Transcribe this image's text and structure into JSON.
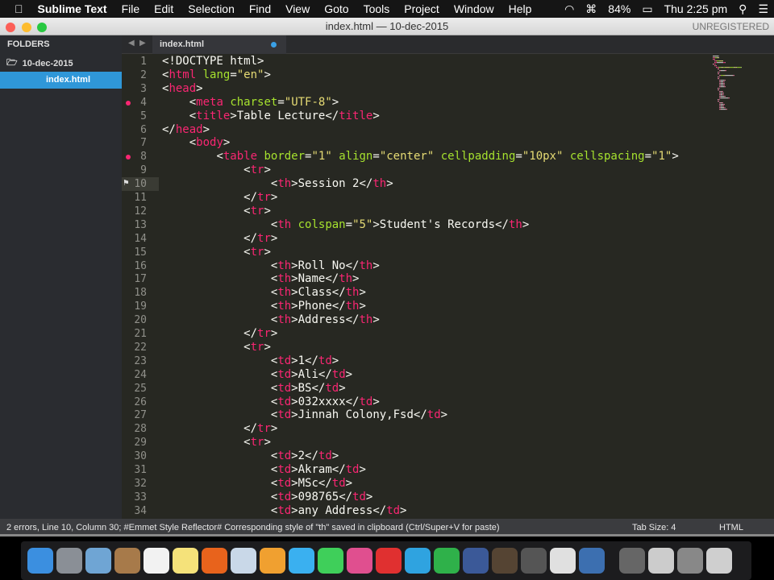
{
  "menubar": {
    "app": "Sublime Text",
    "items": [
      "File",
      "Edit",
      "Selection",
      "Find",
      "View",
      "Goto",
      "Tools",
      "Project",
      "Window",
      "Help"
    ],
    "battery": "84%",
    "clock": "Thu 2:25 pm"
  },
  "window": {
    "title": "index.html — 10-dec-2015",
    "registration": "UNREGISTERED"
  },
  "sidebar": {
    "header": "FOLDERS",
    "folder": "10-dec-2015",
    "file": "index.html"
  },
  "tab": {
    "label": "index.html"
  },
  "editor": {
    "current_line": 10,
    "error_lines": [
      4,
      8
    ],
    "lines": [
      [
        0,
        [
          [
            "p",
            "<!DOCTYPE html>"
          ]
        ]
      ],
      [
        0,
        [
          [
            "p",
            "<"
          ],
          [
            "t",
            "html"
          ],
          [
            "p",
            " "
          ],
          [
            "a",
            "lang"
          ],
          [
            "p",
            "="
          ],
          [
            "s",
            "\"en\""
          ],
          [
            "p",
            ">"
          ]
        ]
      ],
      [
        0,
        [
          [
            "p",
            "<"
          ],
          [
            "t",
            "head"
          ],
          [
            "p",
            ">"
          ]
        ]
      ],
      [
        4,
        [
          [
            "p",
            "<"
          ],
          [
            "t",
            "meta"
          ],
          [
            "p",
            " "
          ],
          [
            "a",
            "charset"
          ],
          [
            "p",
            "="
          ],
          [
            "s",
            "\"UTF-8\""
          ],
          [
            "p",
            ">"
          ]
        ]
      ],
      [
        4,
        [
          [
            "p",
            "<"
          ],
          [
            "t",
            "title"
          ],
          [
            "p",
            ">"
          ],
          [
            "x",
            "Table Lecture"
          ],
          [
            "p",
            "</"
          ],
          [
            "t",
            "title"
          ],
          [
            "p",
            ">"
          ]
        ]
      ],
      [
        0,
        [
          [
            "p",
            "</"
          ],
          [
            "t",
            "head"
          ],
          [
            "p",
            ">"
          ]
        ]
      ],
      [
        4,
        [
          [
            "p",
            "<"
          ],
          [
            "t",
            "body"
          ],
          [
            "p",
            ">"
          ]
        ]
      ],
      [
        8,
        [
          [
            "p",
            "<"
          ],
          [
            "t",
            "table"
          ],
          [
            "p",
            " "
          ],
          [
            "a",
            "border"
          ],
          [
            "p",
            "="
          ],
          [
            "s",
            "\"1\""
          ],
          [
            "p",
            " "
          ],
          [
            "a",
            "align"
          ],
          [
            "p",
            "="
          ],
          [
            "s",
            "\"center\""
          ],
          [
            "p",
            " "
          ],
          [
            "a",
            "cellpadding"
          ],
          [
            "p",
            "="
          ],
          [
            "s",
            "\"10px\""
          ],
          [
            "p",
            " "
          ],
          [
            "a",
            "cellspacing"
          ],
          [
            "p",
            "="
          ],
          [
            "s",
            "\"1\""
          ],
          [
            "p",
            ">"
          ]
        ]
      ],
      [
        12,
        [
          [
            "p",
            "<"
          ],
          [
            "t",
            "tr"
          ],
          [
            "p",
            ">"
          ]
        ]
      ],
      [
        16,
        [
          [
            "p",
            "<"
          ],
          [
            "t",
            "th"
          ],
          [
            "p",
            ">"
          ],
          [
            "x",
            "Session 2"
          ],
          [
            "p",
            "</"
          ],
          [
            "t",
            "th"
          ],
          [
            "p",
            ">"
          ]
        ]
      ],
      [
        12,
        [
          [
            "p",
            "</"
          ],
          [
            "t",
            "tr"
          ],
          [
            "p",
            ">"
          ]
        ]
      ],
      [
        12,
        [
          [
            "p",
            "<"
          ],
          [
            "t",
            "tr"
          ],
          [
            "p",
            ">"
          ]
        ]
      ],
      [
        16,
        [
          [
            "p",
            "<"
          ],
          [
            "t",
            "th"
          ],
          [
            "p",
            " "
          ],
          [
            "a",
            "colspan"
          ],
          [
            "p",
            "="
          ],
          [
            "s",
            "\"5\""
          ],
          [
            "p",
            ">"
          ],
          [
            "x",
            "Student's Records"
          ],
          [
            "p",
            "</"
          ],
          [
            "t",
            "th"
          ],
          [
            "p",
            ">"
          ]
        ]
      ],
      [
        12,
        [
          [
            "p",
            "</"
          ],
          [
            "t",
            "tr"
          ],
          [
            "p",
            ">"
          ]
        ]
      ],
      [
        12,
        [
          [
            "p",
            "<"
          ],
          [
            "t",
            "tr"
          ],
          [
            "p",
            ">"
          ]
        ]
      ],
      [
        16,
        [
          [
            "p",
            "<"
          ],
          [
            "t",
            "th"
          ],
          [
            "p",
            ">"
          ],
          [
            "x",
            "Roll No"
          ],
          [
            "p",
            "</"
          ],
          [
            "t",
            "th"
          ],
          [
            "p",
            ">"
          ]
        ]
      ],
      [
        16,
        [
          [
            "p",
            "<"
          ],
          [
            "t",
            "th"
          ],
          [
            "p",
            ">"
          ],
          [
            "x",
            "Name"
          ],
          [
            "p",
            "</"
          ],
          [
            "t",
            "th"
          ],
          [
            "p",
            ">"
          ]
        ]
      ],
      [
        16,
        [
          [
            "p",
            "<"
          ],
          [
            "t",
            "th"
          ],
          [
            "p",
            ">"
          ],
          [
            "x",
            "Class"
          ],
          [
            "p",
            "</"
          ],
          [
            "t",
            "th"
          ],
          [
            "p",
            ">"
          ]
        ]
      ],
      [
        16,
        [
          [
            "p",
            "<"
          ],
          [
            "t",
            "th"
          ],
          [
            "p",
            ">"
          ],
          [
            "x",
            "Phone"
          ],
          [
            "p",
            "</"
          ],
          [
            "t",
            "th"
          ],
          [
            "p",
            ">"
          ]
        ]
      ],
      [
        16,
        [
          [
            "p",
            "<"
          ],
          [
            "t",
            "th"
          ],
          [
            "p",
            ">"
          ],
          [
            "x",
            "Address"
          ],
          [
            "p",
            "</"
          ],
          [
            "t",
            "th"
          ],
          [
            "p",
            ">"
          ]
        ]
      ],
      [
        12,
        [
          [
            "p",
            "</"
          ],
          [
            "t",
            "tr"
          ],
          [
            "p",
            ">"
          ]
        ]
      ],
      [
        12,
        [
          [
            "p",
            "<"
          ],
          [
            "t",
            "tr"
          ],
          [
            "p",
            ">"
          ]
        ]
      ],
      [
        16,
        [
          [
            "p",
            "<"
          ],
          [
            "t",
            "td"
          ],
          [
            "p",
            ">"
          ],
          [
            "x",
            "1"
          ],
          [
            "p",
            "</"
          ],
          [
            "t",
            "td"
          ],
          [
            "p",
            ">"
          ]
        ]
      ],
      [
        16,
        [
          [
            "p",
            "<"
          ],
          [
            "t",
            "td"
          ],
          [
            "p",
            ">"
          ],
          [
            "x",
            "Ali"
          ],
          [
            "p",
            "</"
          ],
          [
            "t",
            "td"
          ],
          [
            "p",
            ">"
          ]
        ]
      ],
      [
        16,
        [
          [
            "p",
            "<"
          ],
          [
            "t",
            "td"
          ],
          [
            "p",
            ">"
          ],
          [
            "x",
            "BS"
          ],
          [
            "p",
            "</"
          ],
          [
            "t",
            "td"
          ],
          [
            "p",
            ">"
          ]
        ]
      ],
      [
        16,
        [
          [
            "p",
            "<"
          ],
          [
            "t",
            "td"
          ],
          [
            "p",
            ">"
          ],
          [
            "x",
            "032xxxx"
          ],
          [
            "p",
            "</"
          ],
          [
            "t",
            "td"
          ],
          [
            "p",
            ">"
          ]
        ]
      ],
      [
        16,
        [
          [
            "p",
            "<"
          ],
          [
            "t",
            "td"
          ],
          [
            "p",
            ">"
          ],
          [
            "x",
            "Jinnah Colony,Fsd"
          ],
          [
            "p",
            "</"
          ],
          [
            "t",
            "td"
          ],
          [
            "p",
            ">"
          ]
        ]
      ],
      [
        12,
        [
          [
            "p",
            "</"
          ],
          [
            "t",
            "tr"
          ],
          [
            "p",
            ">"
          ]
        ]
      ],
      [
        12,
        [
          [
            "p",
            "<"
          ],
          [
            "t",
            "tr"
          ],
          [
            "p",
            ">"
          ]
        ]
      ],
      [
        16,
        [
          [
            "p",
            "<"
          ],
          [
            "t",
            "td"
          ],
          [
            "p",
            ">"
          ],
          [
            "x",
            "2"
          ],
          [
            "p",
            "</"
          ],
          [
            "t",
            "td"
          ],
          [
            "p",
            ">"
          ]
        ]
      ],
      [
        16,
        [
          [
            "p",
            "<"
          ],
          [
            "t",
            "td"
          ],
          [
            "p",
            ">"
          ],
          [
            "x",
            "Akram"
          ],
          [
            "p",
            "</"
          ],
          [
            "t",
            "td"
          ],
          [
            "p",
            ">"
          ]
        ]
      ],
      [
        16,
        [
          [
            "p",
            "<"
          ],
          [
            "t",
            "td"
          ],
          [
            "p",
            ">"
          ],
          [
            "x",
            "MSc"
          ],
          [
            "p",
            "</"
          ],
          [
            "t",
            "td"
          ],
          [
            "p",
            ">"
          ]
        ]
      ],
      [
        16,
        [
          [
            "p",
            "<"
          ],
          [
            "t",
            "td"
          ],
          [
            "p",
            ">"
          ],
          [
            "x",
            "098765"
          ],
          [
            "p",
            "</"
          ],
          [
            "t",
            "td"
          ],
          [
            "p",
            ">"
          ]
        ]
      ],
      [
        16,
        [
          [
            "p",
            "<"
          ],
          [
            "t",
            "td"
          ],
          [
            "p",
            ">"
          ],
          [
            "x",
            "any Address"
          ],
          [
            "p",
            "</"
          ],
          [
            "t",
            "td"
          ],
          [
            "p",
            ">"
          ]
        ]
      ]
    ]
  },
  "status": {
    "message": "2 errors, Line 10, Column 30; #Emmet Style Reflector# Corresponding style of \"th\" saved in clipboard (Ctrl/Super+V for paste)",
    "tab_size": "Tab Size: 4",
    "syntax": "HTML"
  },
  "dock": {
    "apps": [
      [
        "finder",
        "#3b8fe0"
      ],
      [
        "launchpad",
        "#8a8f96"
      ],
      [
        "preview",
        "#6fa5d4"
      ],
      [
        "contacts",
        "#a77a4a"
      ],
      [
        "reminders",
        "#f2f2f2"
      ],
      [
        "notes",
        "#f5e27a"
      ],
      [
        "firefox",
        "#e8631c"
      ],
      [
        "photo-tool",
        "#c9d8e8"
      ],
      [
        "photos",
        "#f0a030"
      ],
      [
        "messages",
        "#3ab0f0"
      ],
      [
        "facetime",
        "#3fcf5a"
      ],
      [
        "itunes",
        "#e04f8f"
      ],
      [
        "powerpoint",
        "#e03030"
      ],
      [
        "word",
        "#2fa3e0"
      ],
      [
        "excel",
        "#2fb14a"
      ],
      [
        "facebook",
        "#3b5998"
      ],
      [
        "photo",
        "#554433"
      ],
      [
        "sublime-text",
        "#555"
      ],
      [
        "evernote",
        "#e0e0e0"
      ],
      [
        "quicktime",
        "#3c6fb0"
      ],
      [
        "window-1",
        "#666"
      ],
      [
        "window-2",
        "#ccc"
      ],
      [
        "window-3",
        "#888"
      ],
      [
        "trash",
        "#cfcfcf"
      ]
    ]
  }
}
